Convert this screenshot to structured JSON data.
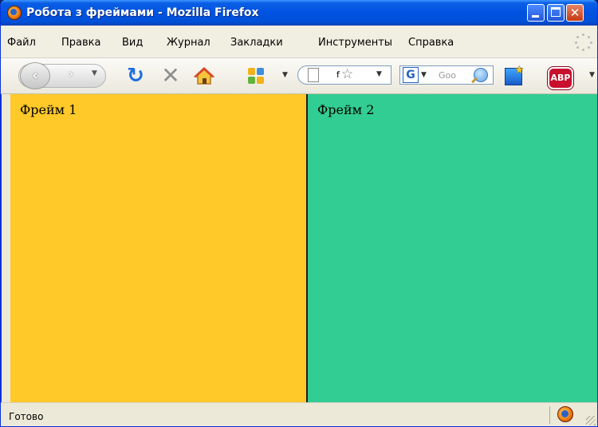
{
  "window": {
    "title": "Робота з фреймами - Mozilla Firefox"
  },
  "menu": {
    "items": [
      {
        "label": "Файл"
      },
      {
        "label": "Правка"
      },
      {
        "label": "Вид"
      },
      {
        "label": "Журнал"
      },
      {
        "label": "Закладки"
      },
      {
        "label": "Инструменты"
      },
      {
        "label": "Справка"
      }
    ]
  },
  "navbar": {
    "url_text": "f",
    "search_placeholder": "Goo",
    "abp_label": "ABP"
  },
  "frames": {
    "left": {
      "label": "Фрейм 1",
      "background": "#ffc929"
    },
    "right": {
      "label": "Фрейм 2",
      "background": "#32cd92"
    }
  },
  "status": {
    "text": "Готово"
  }
}
